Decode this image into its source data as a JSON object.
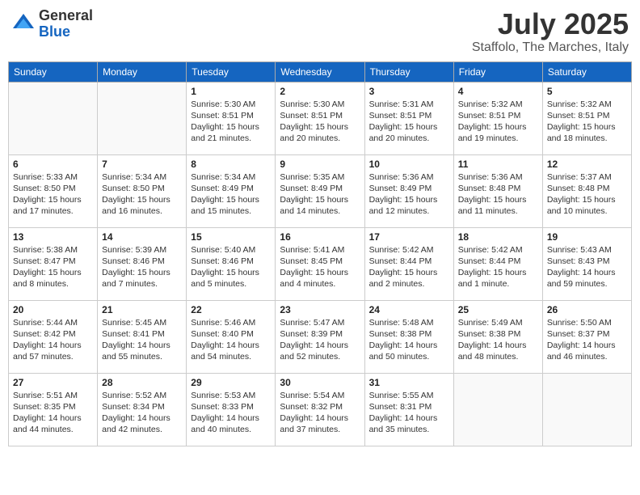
{
  "header": {
    "logo_general": "General",
    "logo_blue": "Blue",
    "month": "July 2025",
    "location": "Staffolo, The Marches, Italy"
  },
  "weekdays": [
    "Sunday",
    "Monday",
    "Tuesday",
    "Wednesday",
    "Thursday",
    "Friday",
    "Saturday"
  ],
  "weeks": [
    [
      {
        "day": "",
        "detail": ""
      },
      {
        "day": "",
        "detail": ""
      },
      {
        "day": "1",
        "detail": "Sunrise: 5:30 AM\nSunset: 8:51 PM\nDaylight: 15 hours\nand 21 minutes."
      },
      {
        "day": "2",
        "detail": "Sunrise: 5:30 AM\nSunset: 8:51 PM\nDaylight: 15 hours\nand 20 minutes."
      },
      {
        "day": "3",
        "detail": "Sunrise: 5:31 AM\nSunset: 8:51 PM\nDaylight: 15 hours\nand 20 minutes."
      },
      {
        "day": "4",
        "detail": "Sunrise: 5:32 AM\nSunset: 8:51 PM\nDaylight: 15 hours\nand 19 minutes."
      },
      {
        "day": "5",
        "detail": "Sunrise: 5:32 AM\nSunset: 8:51 PM\nDaylight: 15 hours\nand 18 minutes."
      }
    ],
    [
      {
        "day": "6",
        "detail": "Sunrise: 5:33 AM\nSunset: 8:50 PM\nDaylight: 15 hours\nand 17 minutes."
      },
      {
        "day": "7",
        "detail": "Sunrise: 5:34 AM\nSunset: 8:50 PM\nDaylight: 15 hours\nand 16 minutes."
      },
      {
        "day": "8",
        "detail": "Sunrise: 5:34 AM\nSunset: 8:49 PM\nDaylight: 15 hours\nand 15 minutes."
      },
      {
        "day": "9",
        "detail": "Sunrise: 5:35 AM\nSunset: 8:49 PM\nDaylight: 15 hours\nand 14 minutes."
      },
      {
        "day": "10",
        "detail": "Sunrise: 5:36 AM\nSunset: 8:49 PM\nDaylight: 15 hours\nand 12 minutes."
      },
      {
        "day": "11",
        "detail": "Sunrise: 5:36 AM\nSunset: 8:48 PM\nDaylight: 15 hours\nand 11 minutes."
      },
      {
        "day": "12",
        "detail": "Sunrise: 5:37 AM\nSunset: 8:48 PM\nDaylight: 15 hours\nand 10 minutes."
      }
    ],
    [
      {
        "day": "13",
        "detail": "Sunrise: 5:38 AM\nSunset: 8:47 PM\nDaylight: 15 hours\nand 8 minutes."
      },
      {
        "day": "14",
        "detail": "Sunrise: 5:39 AM\nSunset: 8:46 PM\nDaylight: 15 hours\nand 7 minutes."
      },
      {
        "day": "15",
        "detail": "Sunrise: 5:40 AM\nSunset: 8:46 PM\nDaylight: 15 hours\nand 5 minutes."
      },
      {
        "day": "16",
        "detail": "Sunrise: 5:41 AM\nSunset: 8:45 PM\nDaylight: 15 hours\nand 4 minutes."
      },
      {
        "day": "17",
        "detail": "Sunrise: 5:42 AM\nSunset: 8:44 PM\nDaylight: 15 hours\nand 2 minutes."
      },
      {
        "day": "18",
        "detail": "Sunrise: 5:42 AM\nSunset: 8:44 PM\nDaylight: 15 hours\nand 1 minute."
      },
      {
        "day": "19",
        "detail": "Sunrise: 5:43 AM\nSunset: 8:43 PM\nDaylight: 14 hours\nand 59 minutes."
      }
    ],
    [
      {
        "day": "20",
        "detail": "Sunrise: 5:44 AM\nSunset: 8:42 PM\nDaylight: 14 hours\nand 57 minutes."
      },
      {
        "day": "21",
        "detail": "Sunrise: 5:45 AM\nSunset: 8:41 PM\nDaylight: 14 hours\nand 55 minutes."
      },
      {
        "day": "22",
        "detail": "Sunrise: 5:46 AM\nSunset: 8:40 PM\nDaylight: 14 hours\nand 54 minutes."
      },
      {
        "day": "23",
        "detail": "Sunrise: 5:47 AM\nSunset: 8:39 PM\nDaylight: 14 hours\nand 52 minutes."
      },
      {
        "day": "24",
        "detail": "Sunrise: 5:48 AM\nSunset: 8:38 PM\nDaylight: 14 hours\nand 50 minutes."
      },
      {
        "day": "25",
        "detail": "Sunrise: 5:49 AM\nSunset: 8:38 PM\nDaylight: 14 hours\nand 48 minutes."
      },
      {
        "day": "26",
        "detail": "Sunrise: 5:50 AM\nSunset: 8:37 PM\nDaylight: 14 hours\nand 46 minutes."
      }
    ],
    [
      {
        "day": "27",
        "detail": "Sunrise: 5:51 AM\nSunset: 8:35 PM\nDaylight: 14 hours\nand 44 minutes."
      },
      {
        "day": "28",
        "detail": "Sunrise: 5:52 AM\nSunset: 8:34 PM\nDaylight: 14 hours\nand 42 minutes."
      },
      {
        "day": "29",
        "detail": "Sunrise: 5:53 AM\nSunset: 8:33 PM\nDaylight: 14 hours\nand 40 minutes."
      },
      {
        "day": "30",
        "detail": "Sunrise: 5:54 AM\nSunset: 8:32 PM\nDaylight: 14 hours\nand 37 minutes."
      },
      {
        "day": "31",
        "detail": "Sunrise: 5:55 AM\nSunset: 8:31 PM\nDaylight: 14 hours\nand 35 minutes."
      },
      {
        "day": "",
        "detail": ""
      },
      {
        "day": "",
        "detail": ""
      }
    ]
  ]
}
